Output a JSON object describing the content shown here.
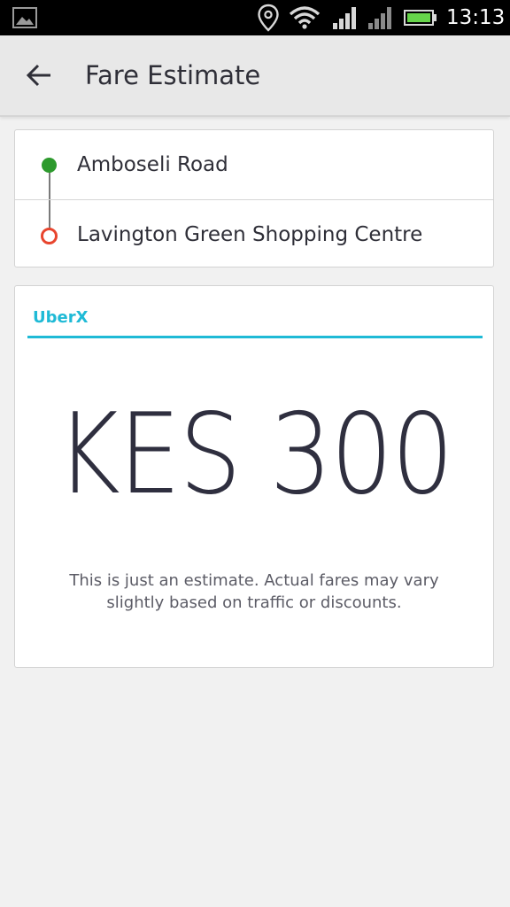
{
  "status_bar": {
    "time": "13:13",
    "icons": [
      "gallery-icon",
      "location-icon",
      "wifi-icon",
      "signal-icon",
      "signal-icon",
      "battery-icon"
    ],
    "battery_color": "#66d44a"
  },
  "app_bar": {
    "back_icon": "arrow-left-icon",
    "title": "Fare Estimate"
  },
  "route": {
    "pickup": "Amboseli Road",
    "dropoff": "Lavington Green Shopping Centre",
    "pickup_color": "#2d9a2d",
    "dropoff_color": "#e8452e"
  },
  "fare": {
    "product": "UberX",
    "amount": "KES 300",
    "disclaimer": "This is just an estimate. Actual fares may vary slightly based on traffic or discounts.",
    "accent_color": "#1fbad6"
  }
}
